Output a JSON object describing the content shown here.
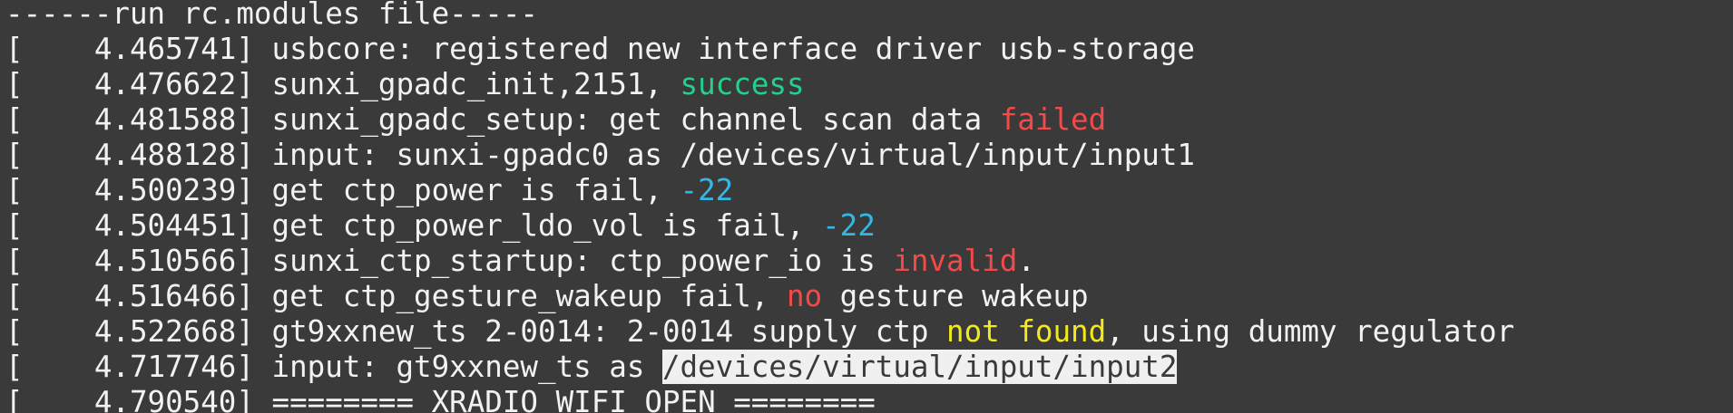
{
  "terminal": {
    "colors": {
      "background": "#3a3a3a",
      "text": "#f2f2f2",
      "green": "#22d18b",
      "red": "#f24a4a",
      "cyan": "#33b8e6",
      "yellow": "#f2e81c",
      "highlight_bg": "#f0f0f0"
    },
    "lines": [
      {
        "segments": [
          {
            "text": "------run rc.modules file-----"
          }
        ]
      },
      {
        "segments": [
          {
            "text": "[    4.465741] usbcore: registered new interface driver usb-storage"
          }
        ]
      },
      {
        "segments": [
          {
            "text": "[    4.476622] sunxi_gpadc_init,2151, "
          },
          {
            "text": "success",
            "style": "c-green"
          }
        ]
      },
      {
        "segments": [
          {
            "text": "[    4.481588] sunxi_gpadc_setup: get channel scan data "
          },
          {
            "text": "failed",
            "style": "c-red"
          }
        ]
      },
      {
        "segments": [
          {
            "text": "[    4.488128] input: sunxi-gpadc0 as /devices/virtual/input/input1"
          }
        ]
      },
      {
        "segments": [
          {
            "text": "[    4.500239] get ctp_power is fail, "
          },
          {
            "text": "-22",
            "style": "c-cyan"
          }
        ]
      },
      {
        "segments": [
          {
            "text": "[    4.504451] get ctp_power_ldo_vol is fail, "
          },
          {
            "text": "-22",
            "style": "c-cyan"
          }
        ]
      },
      {
        "segments": [
          {
            "text": "[    4.510566] sunxi_ctp_startup: ctp_power_io is "
          },
          {
            "text": "invalid",
            "style": "c-red"
          },
          {
            "text": "."
          }
        ]
      },
      {
        "segments": [
          {
            "text": "[    4.516466] get ctp_gesture_wakeup fail, "
          },
          {
            "text": "no",
            "style": "c-red"
          },
          {
            "text": " gesture wakeup"
          }
        ]
      },
      {
        "segments": [
          {
            "text": "[    4.522668] gt9xxnew_ts 2-0014: 2-0014 supply ctp "
          },
          {
            "text": "not found",
            "style": "c-yellow"
          },
          {
            "text": ", using dummy regulator"
          }
        ]
      },
      {
        "segments": [
          {
            "text": "[    4.717746] input: gt9xxnew_ts as "
          },
          {
            "text": "/devices/virtual/input/input2",
            "style": "c-hl"
          }
        ]
      },
      {
        "segments": [
          {
            "text": "[    4.790540] ======== XRADIO WIFI OPEN ========"
          }
        ]
      }
    ]
  }
}
